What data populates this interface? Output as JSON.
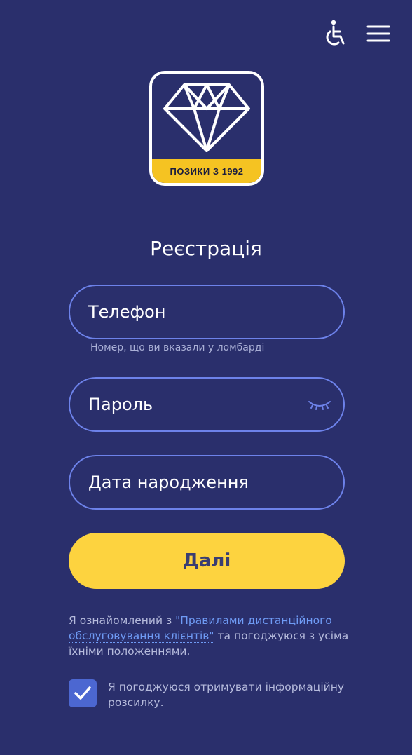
{
  "header": {
    "accessibility_icon": "wheelchair-icon",
    "menu_icon": "hamburger-menu-icon"
  },
  "logo": {
    "icon": "diamond-icon",
    "tagline": "ПОЗИКИ З 1992"
  },
  "title": "Реєстрація",
  "form": {
    "phone": {
      "label": "Телефон",
      "hint": "Номер, що ви вказали у ломбарді"
    },
    "password": {
      "label": "Пароль",
      "toggle_icon": "eye-closed-icon"
    },
    "birthdate": {
      "label": "Дата народження"
    }
  },
  "submit_label": "Далі",
  "terms": {
    "prefix": "Я ознайомлений з ",
    "link": "\"Правилами дистанційного обслуговування клієнтів\"",
    "suffix": " та погоджуюся з усіма їхніми положеннями."
  },
  "newsletter": {
    "checked": true,
    "label": "Я погоджуюся отримувати інформаційну розсилку."
  },
  "colors": {
    "background": "#2a2f6c",
    "field_border": "#6d82ea",
    "button": "#fdd33f",
    "link": "#6f9bf5",
    "checkbox": "#4c67d1",
    "logo_band": "#f5c322"
  }
}
